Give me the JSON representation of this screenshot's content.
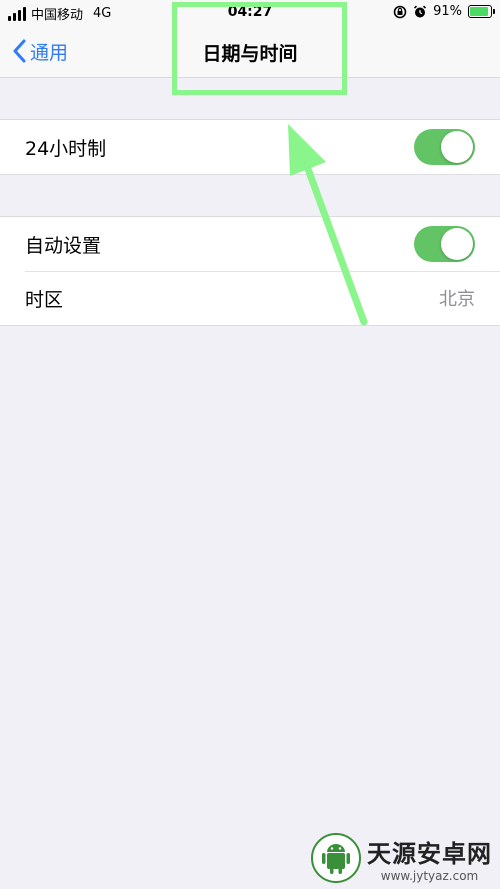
{
  "status_bar": {
    "carrier": "中国移动",
    "network": "4G",
    "time": "04:27",
    "battery_percent": "91%",
    "battery_level": 0.91
  },
  "nav": {
    "back_label": "通用",
    "title": "日期与时间"
  },
  "settings": {
    "hour24": {
      "label": "24小时制",
      "enabled": true
    },
    "auto_set": {
      "label": "自动设置",
      "enabled": true
    },
    "timezone": {
      "label": "时区",
      "value": "北京"
    }
  },
  "watermark": {
    "title": "天源安卓网",
    "url": "www.jytyaz.com"
  },
  "colors": {
    "accent": "#2f7cf6",
    "toggle_on": "#63c466",
    "annotation": "#8af58b"
  }
}
